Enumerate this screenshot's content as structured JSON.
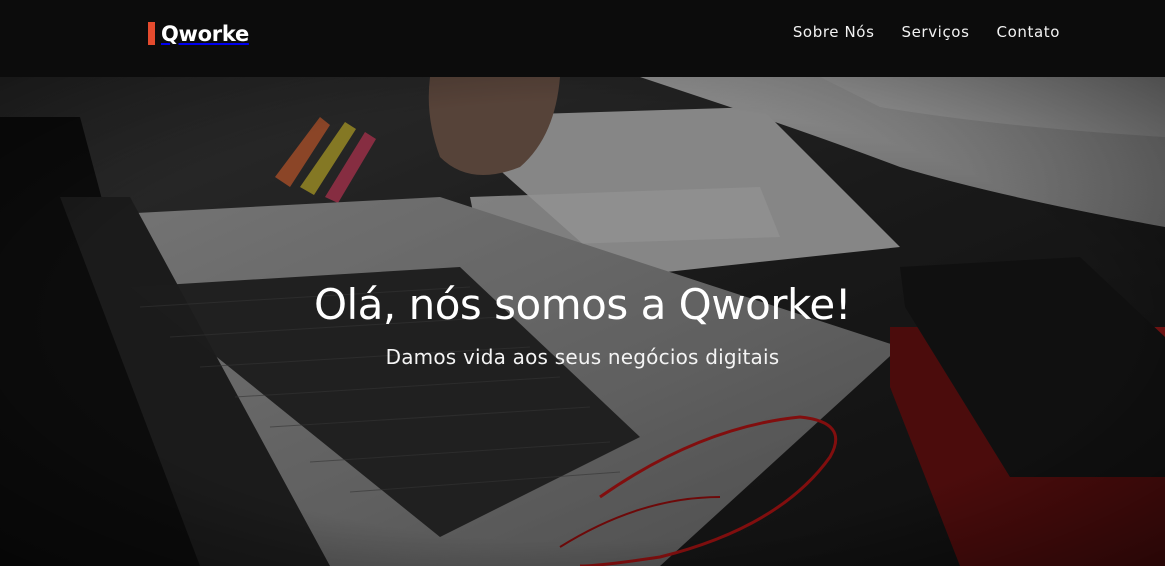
{
  "header": {
    "logo_text": "Qworke",
    "nav": [
      {
        "label": "Sobre Nós"
      },
      {
        "label": "Serviços"
      },
      {
        "label": "Contato"
      }
    ]
  },
  "hero": {
    "title": "Olá, nós somos a Qworke!",
    "subtitle": "Damos vida aos seus negócios digitais",
    "background_image": "laptop-desk-photo"
  },
  "colors": {
    "brand_accent": "#e54b2e",
    "header_bg": "#0c0c0c",
    "text": "#ffffff"
  }
}
